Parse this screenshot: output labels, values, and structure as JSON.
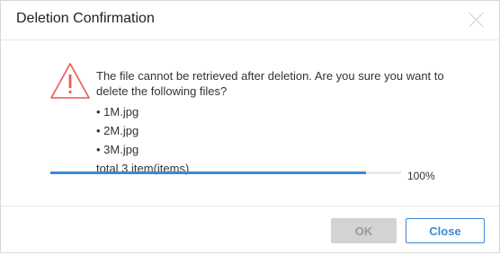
{
  "dialog": {
    "title": "Deletion Confirmation",
    "message": "The file cannot be retrieved after deletion. Are you sure you want to delete the following files?",
    "files": [
      {
        "name": "• 1M.jpg"
      },
      {
        "name": "• 2M.jpg"
      },
      {
        "name": "• 3M.jpg"
      }
    ],
    "total": "total 3 item(items)",
    "progress": {
      "label": "100%",
      "fraction": 0.9
    },
    "icons": {
      "close": "close-icon",
      "warning": "warning-icon"
    },
    "buttons": {
      "ok": "OK",
      "close": "Close"
    },
    "colors": {
      "accent": "#3c88d8",
      "warning": "#e8594f",
      "disabled_bg": "#d3d3d3"
    }
  }
}
